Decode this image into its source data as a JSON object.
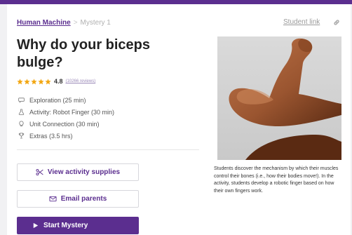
{
  "header": {
    "accent_color": "#5b2e8f"
  },
  "breadcrumb": {
    "parent": "Human Machine",
    "separator": ">",
    "current": "Mystery 1"
  },
  "student_link": {
    "label": "Student link",
    "icon": "link-icon"
  },
  "lesson": {
    "title": "Why do your biceps bulge?",
    "rating": {
      "stars": 5,
      "score": "4.8",
      "reviews": "(10266 reviews)"
    },
    "segments": [
      {
        "icon": "chat-bubble-icon",
        "label": "Exploration (25 min)"
      },
      {
        "icon": "flask-icon",
        "label": "Activity: Robot Finger (30 min)"
      },
      {
        "icon": "lightbulb-icon",
        "label": "Unit Connection (30 min)"
      },
      {
        "icon": "trophy-icon",
        "label": "Extras (3.5 hrs)"
      }
    ],
    "description": "Students discover the mechanism by which their muscles control their bones (i.e., how their bodies move!). In the activity, students develop a robotic finger based on how their own fingers work."
  },
  "actions": {
    "supplies_label": "View activity supplies",
    "email_label": "Email parents",
    "start_label": "Start Mystery"
  },
  "image": {
    "subject": "flexed biceps arm photo"
  }
}
